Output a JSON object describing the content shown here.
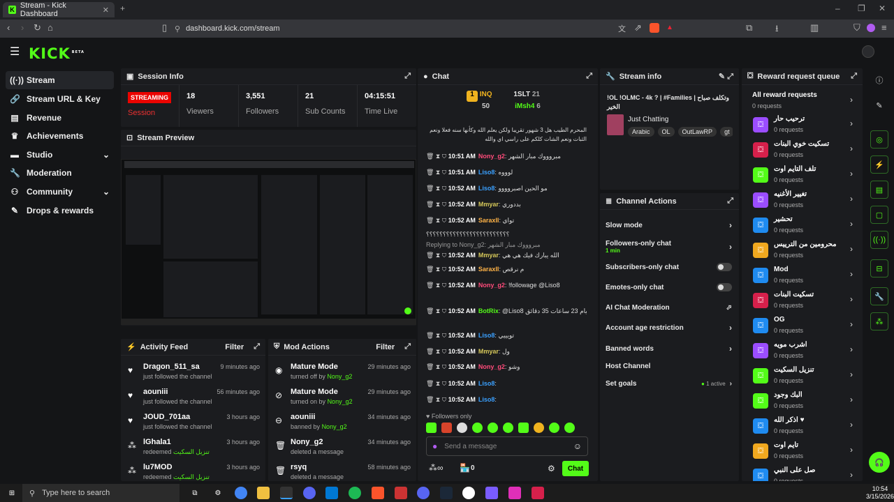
{
  "browser": {
    "tab_title": "Stream - Kick Dashboard",
    "url": "dashboard.kick.com/stream"
  },
  "brand": {
    "logo": "KICK",
    "beta": "BETA",
    "accent": "#53fc18"
  },
  "sidebar": {
    "items": [
      {
        "label": "Stream",
        "icon": "stream-icon"
      },
      {
        "label": "Stream URL & Key",
        "icon": "link-icon"
      },
      {
        "label": "Revenue",
        "icon": "chart-icon"
      },
      {
        "label": "Achievements",
        "icon": "trophy-icon"
      },
      {
        "label": "Studio",
        "icon": "studio-icon"
      },
      {
        "label": "Moderation",
        "icon": "wrench-icon"
      },
      {
        "label": "Community",
        "icon": "people-icon"
      },
      {
        "label": "Drops & rewards",
        "icon": "gift-icon"
      }
    ]
  },
  "session": {
    "title": "Session Info",
    "badge": "STREAMING",
    "badge_label": "Session",
    "stats": [
      {
        "value": "18",
        "label": "Viewers"
      },
      {
        "value": "3,551",
        "label": "Followers"
      },
      {
        "value": "21",
        "label": "Sub Counts"
      },
      {
        "value": "04:15:51",
        "label": "Time Live"
      }
    ]
  },
  "preview": {
    "title": "Stream Preview"
  },
  "activity": {
    "title": "Activity Feed",
    "filter": "Filter",
    "items": [
      {
        "name": "Dragon_511_sa",
        "sub": "just followed the channel",
        "time": "9 minutes ago",
        "icon": "heart-icon"
      },
      {
        "name": "aouniii",
        "sub": "just followed the channel",
        "time": "56 minutes ago",
        "icon": "heart-icon"
      },
      {
        "name": "JOUD_701aa",
        "sub": "just followed the channel",
        "time": "3 hours ago",
        "icon": "heart-icon"
      },
      {
        "name": "lGhala1",
        "sub": "redeemed",
        "extra": "تنزيل السكيت",
        "time": "3 hours ago",
        "icon": "redeem-icon"
      },
      {
        "name": "lu7MOD",
        "sub": "redeemed",
        "extra": "تنزيل السكيت",
        "time": "3 hours ago",
        "icon": "redeem-icon"
      }
    ]
  },
  "mod": {
    "title": "Mod Actions",
    "filter": "Filter",
    "items": [
      {
        "name": "Mature Mode",
        "sub": "turned off by",
        "by": "Nony_g2",
        "time": "29 minutes ago",
        "icon": "eye-icon"
      },
      {
        "name": "Mature Mode",
        "sub": "turned on by",
        "by": "Nony_g2",
        "time": "29 minutes ago",
        "icon": "eye-off-icon"
      },
      {
        "name": "aouniii",
        "sub": "banned by",
        "by": "Nony_g2",
        "time": "34 minutes ago",
        "icon": "ban-icon"
      },
      {
        "name": "Nony_g2",
        "sub": "deleted a message",
        "by": "",
        "time": "34 minutes ago",
        "icon": "trash-icon"
      },
      {
        "name": "rsyq",
        "sub": "deleted a message",
        "by": "",
        "time": "58 minutes ago",
        "icon": "trash-icon"
      }
    ]
  },
  "chat": {
    "title": "Chat",
    "leaders": [
      {
        "rank": "1",
        "name": "INQ",
        "value": "50"
      },
      {
        "name": "1SLT",
        "value": "21"
      },
      {
        "name": "iMsh4",
        "value": "6"
      }
    ],
    "pinned": "المحرم الطيب هل 3 شهور تقريبا ولكن يعلم الله وكأنها سنه فعلا ونعم الثبات ونعم الشات كلكم على راسي اي والله",
    "messages": [
      {
        "time": "10:51 AM",
        "user": "Nony_g2",
        "color": "#ff4b7a",
        "text": "مبروووك مبار الشهر"
      },
      {
        "time": "10:51 AM",
        "user": "Liso8",
        "color": "#3aa0ff",
        "text": "لوووه"
      },
      {
        "time": "10:52 AM",
        "user": "Liso8",
        "color": "#3aa0ff",
        "text": "مو الحين اصبروووو"
      },
      {
        "time": "10:52 AM",
        "user": "Mmyar",
        "color": "#d6c85a",
        "text": "بددوري"
      },
      {
        "time": "10:52 AM",
        "user": "SaraxII",
        "color": "#ffb347",
        "text": "تواي"
      },
      {
        "time": "",
        "user": "",
        "color": "#ddd",
        "text": "؟؟؟؟؟؟؟؟؟؟؟؟؟؟؟؟؟؟؟؟؟؟؟؟؟"
      },
      {
        "time": "",
        "user": "",
        "color": "#999",
        "text": "Replying to Nony_g2: مبروووك مبار الشهر"
      },
      {
        "time": "10:52 AM",
        "user": "Mmyar",
        "color": "#d6c85a",
        "text": "الله يبارك فيك هي هي"
      },
      {
        "time": "10:52 AM",
        "user": "SaraxII",
        "color": "#ffb347",
        "text": "م نرقص"
      },
      {
        "time": "10:52 AM",
        "user": "Nony_g2",
        "color": "#ff4b7a",
        "text": "!followage @Liso8"
      },
      {
        "time": "10:52 AM",
        "user": "BotRix",
        "color": "#53fc18",
        "text": "@Liso8 يتابع القناة منذ 2 أشهر 15 أيام 23 ساعات 35 دقائق !"
      },
      {
        "time": "10:52 AM",
        "user": "Liso8",
        "color": "#3aa0ff",
        "text": "تويييي"
      },
      {
        "time": "10:52 AM",
        "user": "Mmyar",
        "color": "#d6c85a",
        "text": "ول"
      },
      {
        "time": "10:52 AM",
        "user": "Nony_g2",
        "color": "#ff4b7a",
        "text": "وشو"
      },
      {
        "time": "10:52 AM",
        "user": "Liso8",
        "color": "#3aa0ff",
        "text": ""
      },
      {
        "time": "10:52 AM",
        "user": "Liso8",
        "color": "#3aa0ff",
        "text": ""
      }
    ],
    "followers_only": "Followers only",
    "placeholder": "Send a message",
    "count": "0",
    "send": "Chat"
  },
  "stream_info": {
    "title": "Stream info",
    "name": "!OL !OLMC - 4k ? | #Families | وتكلف صباح الخير",
    "category": "Just Chatting",
    "tags": [
      "Arabic",
      "OL",
      "OutLawRP",
      "gt"
    ]
  },
  "channel_actions": {
    "title": "Channel Actions",
    "items": [
      {
        "label": "Slow mode",
        "type": "arrow"
      },
      {
        "label": "Followers-only chat",
        "sub": "1 min",
        "type": "arrow"
      },
      {
        "label": "Subscribers-only chat",
        "type": "toggle"
      },
      {
        "label": "Emotes-only chat",
        "type": "toggle"
      },
      {
        "label": "AI Chat Moderation",
        "type": "ext"
      },
      {
        "label": "Account age restriction",
        "type": "arrow"
      },
      {
        "label": "Banned words",
        "type": "arrow"
      },
      {
        "label": "Host Channel",
        "type": "none"
      },
      {
        "label": "Set goals",
        "sub": "1 active",
        "type": "arrow"
      }
    ]
  },
  "rewards": {
    "title": "Reward request queue",
    "all": "All reward requests",
    "all_sub": "0 requests",
    "items": [
      {
        "t": "ترحيب حار",
        "c": "#9b4dff"
      },
      {
        "t": "تسكيت خوي البنات",
        "c": "#d6204b"
      },
      {
        "t": "تلف التايم اوت",
        "c": "#53fc18"
      },
      {
        "t": "تغيير الأغنيه",
        "c": "#9b4dff"
      },
      {
        "t": "تحشير",
        "c": "#1f8bf0"
      },
      {
        "t": "محرومين من الترييس",
        "c": "#f0a81f"
      },
      {
        "t": "Mod",
        "c": "#1f8bf0"
      },
      {
        "t": "تسكيت البنات",
        "c": "#d6204b"
      },
      {
        "t": "OG",
        "c": "#1f8bf0"
      },
      {
        "t": "اشرب مويه",
        "c": "#9b4dff"
      },
      {
        "t": "تنزيل السكيت",
        "c": "#53fc18"
      },
      {
        "t": "البك وجود",
        "c": "#53fc18"
      },
      {
        "t": "اذكر الله ♥",
        "c": "#1f8bf0"
      },
      {
        "t": "تايم اوت",
        "c": "#f0a81f"
      },
      {
        "t": "صل على النبي",
        "c": "#1f8bf0"
      }
    ],
    "sub": "0 requests"
  },
  "taskbar": {
    "search": "Type here to search",
    "time": "10:54",
    "date": "3/15/2026"
  }
}
